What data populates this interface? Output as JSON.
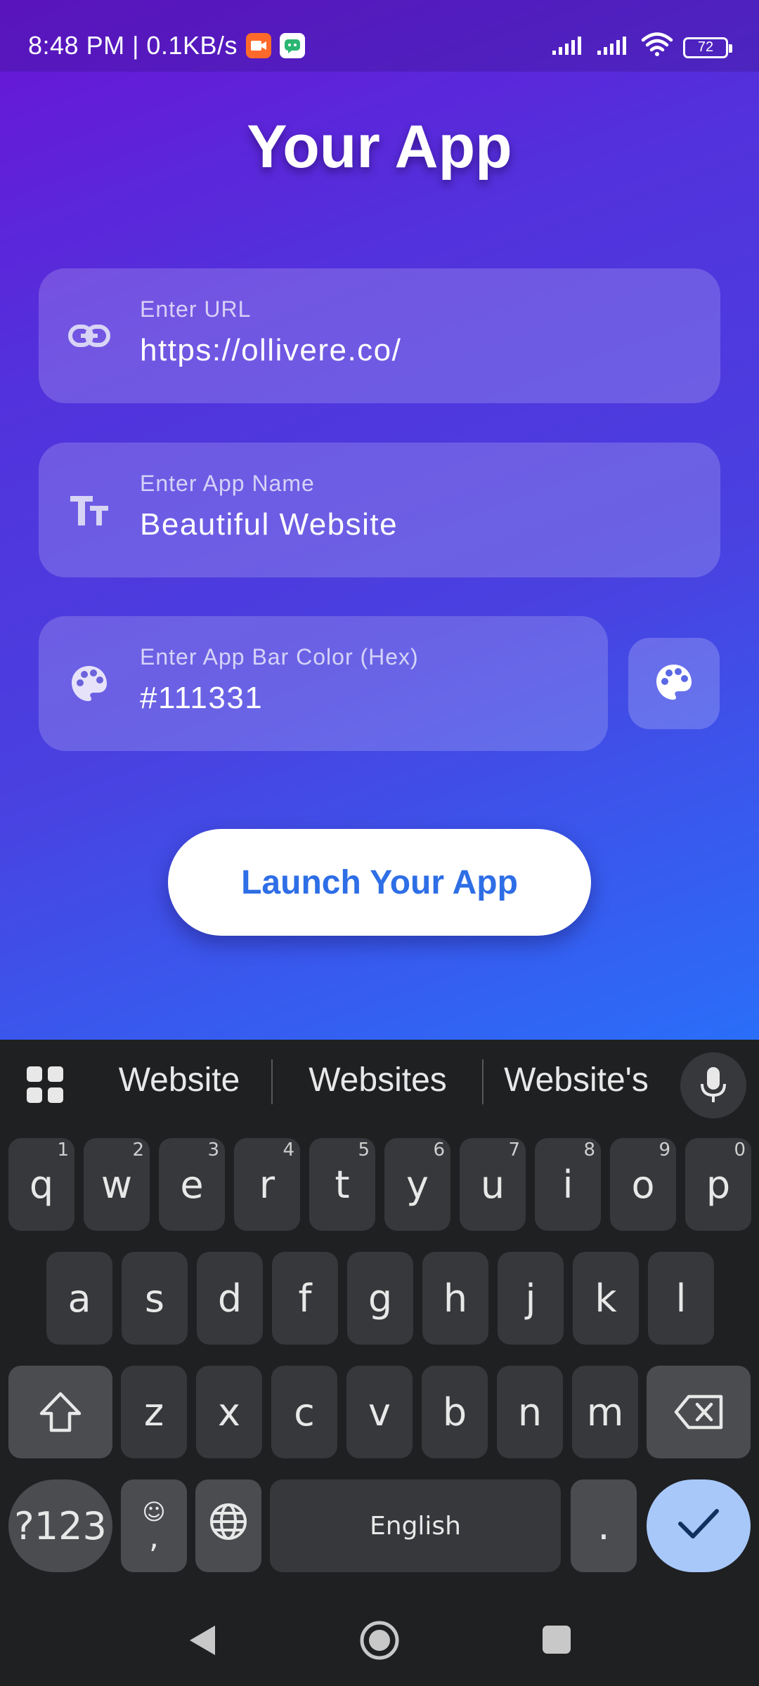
{
  "status": {
    "time": "8:48 PM | 0.1KB/s",
    "battery": "72"
  },
  "app": {
    "title": "Your App",
    "fields": {
      "url": {
        "label": "Enter URL",
        "value": "https://ollivere.co/",
        "icon": "link-icon"
      },
      "name": {
        "label": "Enter App Name",
        "value": "Beautiful Website",
        "icon": "text-size-icon"
      },
      "color": {
        "label": "Enter App Bar Color (Hex)",
        "value": "#111331",
        "icon": "palette-icon"
      }
    },
    "launch_label": "Launch Your App"
  },
  "keyboard": {
    "suggestions": [
      "Website",
      "Websites",
      "Website's"
    ],
    "row1": [
      {
        "k": "q",
        "h": "1"
      },
      {
        "k": "w",
        "h": "2"
      },
      {
        "k": "e",
        "h": "3"
      },
      {
        "k": "r",
        "h": "4"
      },
      {
        "k": "t",
        "h": "5"
      },
      {
        "k": "y",
        "h": "6"
      },
      {
        "k": "u",
        "h": "7"
      },
      {
        "k": "i",
        "h": "8"
      },
      {
        "k": "o",
        "h": "9"
      },
      {
        "k": "p",
        "h": "0"
      }
    ],
    "row2": [
      "a",
      "s",
      "d",
      "f",
      "g",
      "h",
      "j",
      "k",
      "l"
    ],
    "row3": [
      "z",
      "x",
      "c",
      "v",
      "b",
      "n",
      "m"
    ],
    "symbols_label": "?123",
    "comma_label": ",",
    "space_label": "English",
    "period_label": "."
  },
  "colors": {
    "accent": "#2e6ee6",
    "gradient_start": "#6a14d6",
    "gradient_end": "#2a6ef8",
    "enter_key": "#a8c8fa"
  }
}
